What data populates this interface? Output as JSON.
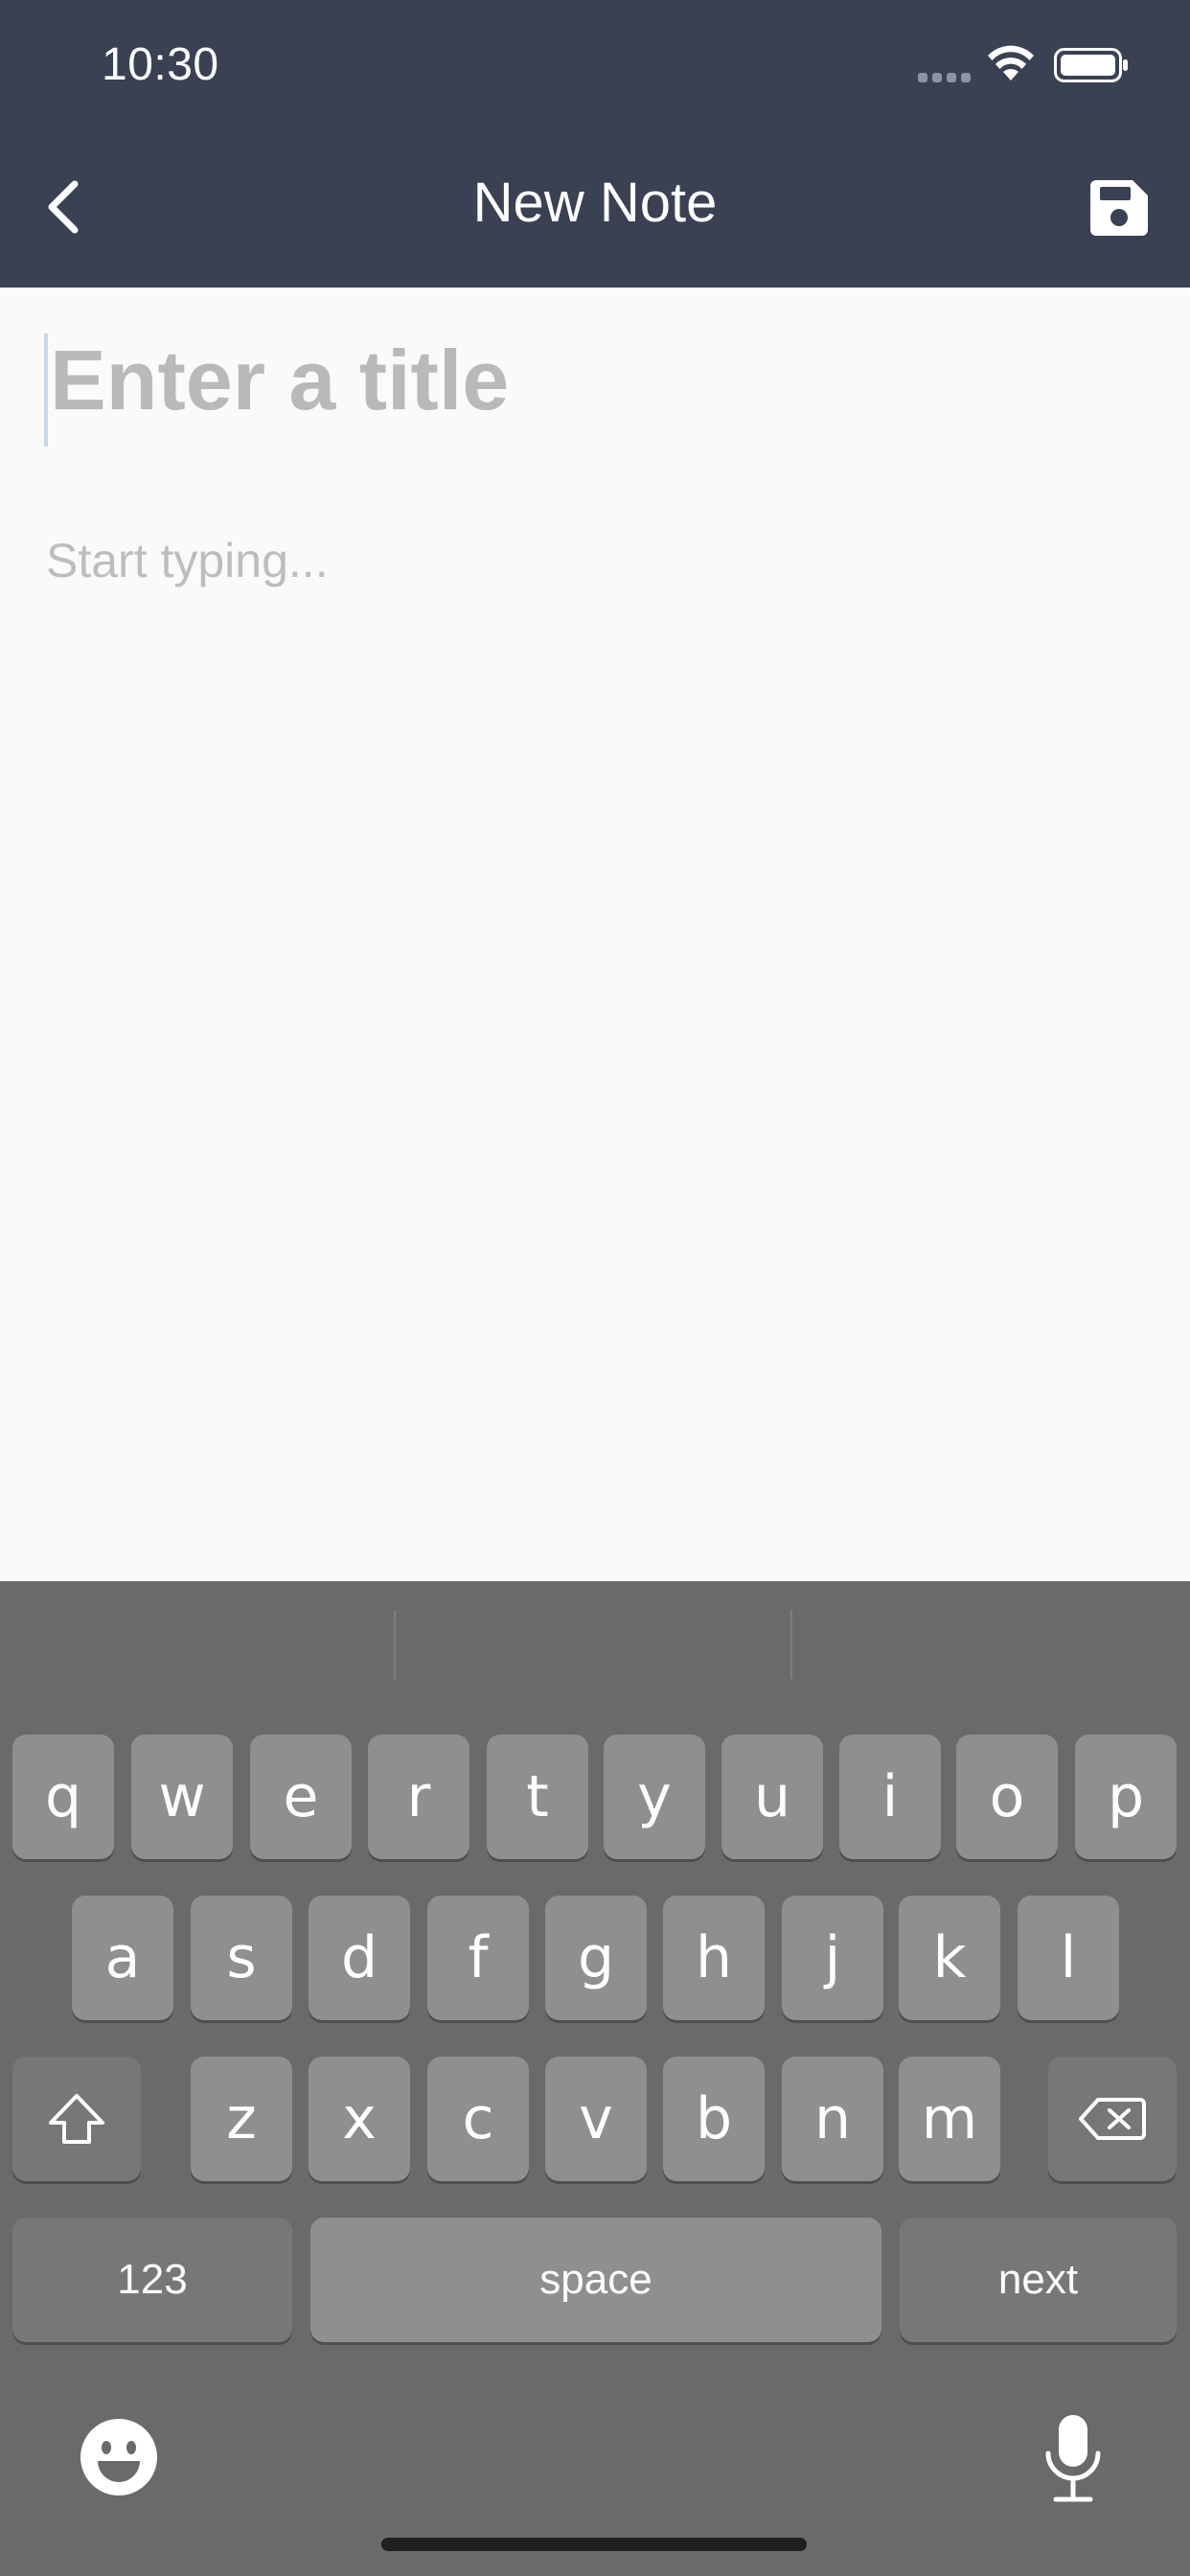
{
  "status_bar": {
    "time": "10:30"
  },
  "nav": {
    "title": "New Note",
    "back_icon": "chevron-left-icon",
    "save_icon": "floppy-disk-icon"
  },
  "editor": {
    "title_placeholder": "Enter a title",
    "title_value": "",
    "body_placeholder": "Start typing...",
    "body_value": ""
  },
  "keyboard": {
    "row1": [
      "q",
      "w",
      "e",
      "r",
      "t",
      "y",
      "u",
      "i",
      "o",
      "p"
    ],
    "row2": [
      "a",
      "s",
      "d",
      "f",
      "g",
      "h",
      "j",
      "k",
      "l"
    ],
    "row3": [
      "z",
      "x",
      "c",
      "v",
      "b",
      "n",
      "m"
    ],
    "shift_icon": "shift-arrow-icon",
    "delete_icon": "backspace-icon",
    "numbers_label": "123",
    "space_label": "space",
    "return_label": "next",
    "emoji_icon": "emoji-face-icon",
    "mic_icon": "microphone-icon"
  },
  "colors": {
    "header_bg": "#394152",
    "keyboard_bg": "#6a6a6a",
    "key_bg": "#8f8f8f",
    "page_bg": "#fafafa"
  }
}
